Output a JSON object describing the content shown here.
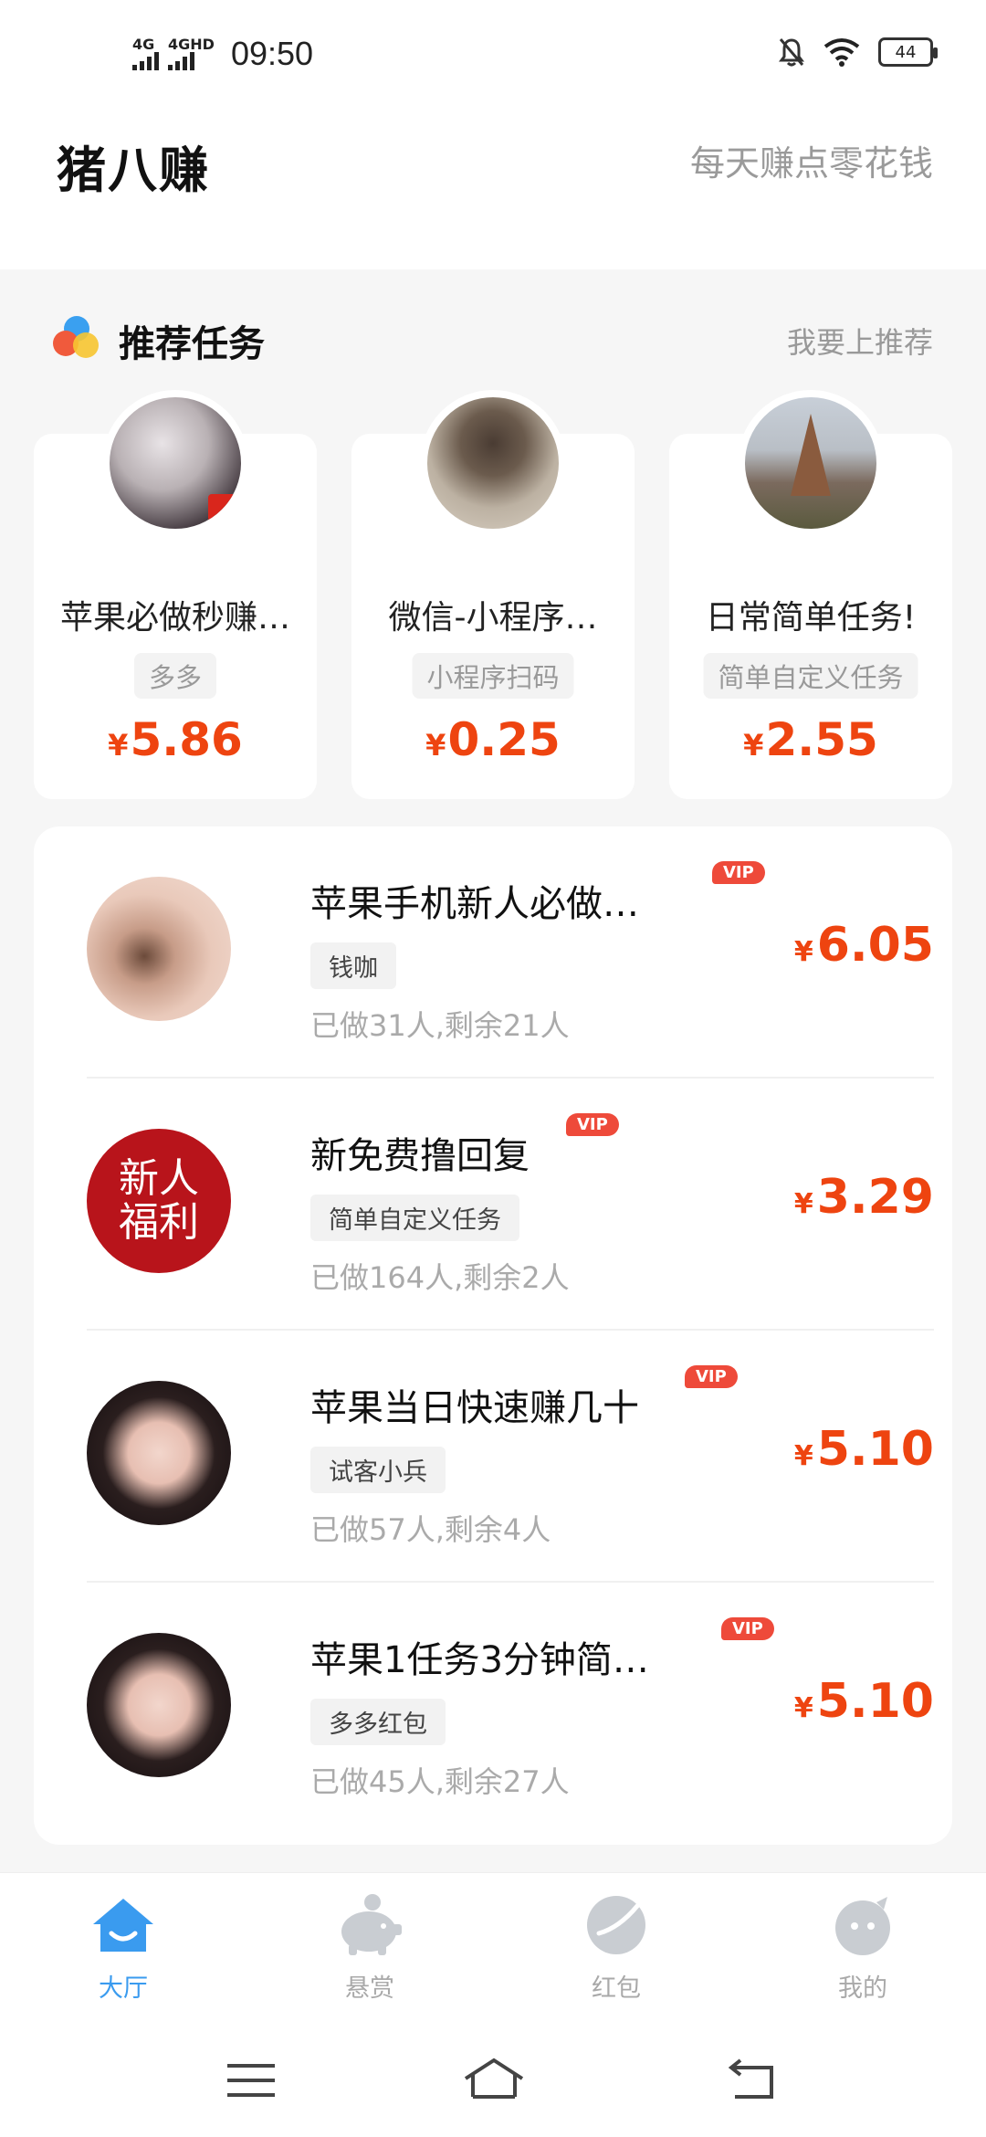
{
  "status_bar": {
    "signal1_label": "4G",
    "signal2_label": "4GHD",
    "time": "09:50",
    "battery": "44"
  },
  "header": {
    "app_title": "猪八赚",
    "slogan": "每天赚点零花钱"
  },
  "recommend": {
    "title": "推荐任务",
    "link": "我要上推荐",
    "cards": [
      {
        "name": "苹果必做秒赚…",
        "tag": "多多",
        "currency": "¥",
        "price": "5.86"
      },
      {
        "name": "微信-小程序…",
        "tag": "小程序扫码",
        "currency": "¥",
        "price": "0.25"
      },
      {
        "name": "日常简单任务!",
        "tag": "简单自定义任务",
        "currency": "¥",
        "price": "2.55"
      }
    ]
  },
  "tasks": [
    {
      "title": "苹果手机新人必做…",
      "vip": "VIP",
      "tag": "钱咖",
      "stats": "已做31人,剩余21人",
      "currency": "¥",
      "price": "6.05"
    },
    {
      "title": "新免费撸回复",
      "vip": "VIP",
      "tag": "简单自定义任务",
      "stats": "已做164人,剩余2人",
      "currency": "¥",
      "price": "3.29",
      "avatar_text_1": "新人",
      "avatar_text_2": "福利"
    },
    {
      "title": "苹果当日快速赚几十",
      "vip": "VIP",
      "tag": "试客小兵",
      "stats": "已做57人,剩余4人",
      "currency": "¥",
      "price": "5.10"
    },
    {
      "title": "苹果1任务3分钟简…",
      "vip": "VIP",
      "tag": "多多红包",
      "stats": "已做45人,剩余27人",
      "currency": "¥",
      "price": "5.10"
    }
  ],
  "bottom_nav": [
    {
      "label": "大厅",
      "icon": "home-icon",
      "active": true
    },
    {
      "label": "悬赏",
      "icon": "piggy-bank-icon",
      "active": false
    },
    {
      "label": "红包",
      "icon": "red-packet-icon",
      "active": false
    },
    {
      "label": "我的",
      "icon": "profile-icon",
      "active": false
    }
  ],
  "colors": {
    "accent_price": "#ee4410",
    "active_tab": "#3a9bef",
    "vip_badge": "#ee4a3a"
  }
}
